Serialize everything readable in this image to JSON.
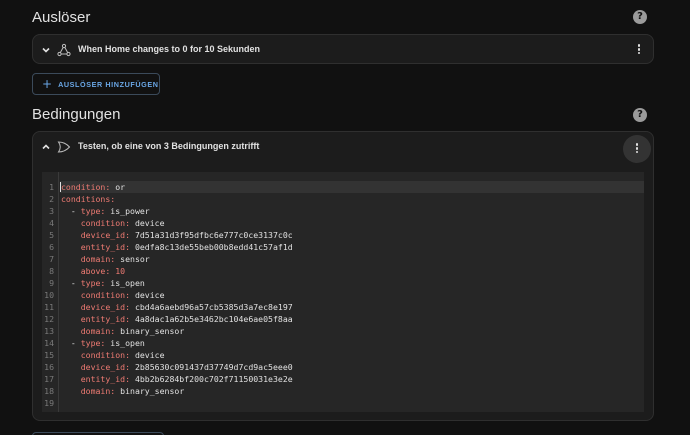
{
  "triggers": {
    "title": "Auslöser",
    "items": [
      {
        "label": "When Home changes to 0 for 10 Sekunden"
      }
    ],
    "add_button_label": "AUSLÖSER HINZUFÜGEN"
  },
  "conditions": {
    "title": "Bedingungen",
    "items": [
      {
        "label": "Testen, ob eine von 3 Bedingungen zutrifft"
      }
    ]
  },
  "editor": {
    "lines": [
      {
        "n": "1",
        "indent": "",
        "key": "condition:",
        "value": " or"
      },
      {
        "n": "2",
        "indent": "",
        "key": "conditions:",
        "value": ""
      },
      {
        "n": "3",
        "indent": "  - ",
        "key": "type:",
        "value": " is_power"
      },
      {
        "n": "4",
        "indent": "    ",
        "key": "condition:",
        "value": " device"
      },
      {
        "n": "5",
        "indent": "    ",
        "key": "device_id:",
        "value": " 7d51a31d3f95dfbc6e777c0ce3137c0c"
      },
      {
        "n": "6",
        "indent": "    ",
        "key": "entity_id:",
        "value": " 0edfa8c13de55beb00b8edd41c57af1d"
      },
      {
        "n": "7",
        "indent": "    ",
        "key": "domain:",
        "value": " sensor"
      },
      {
        "n": "8",
        "indent": "    ",
        "key": "above:",
        "value": "",
        "num": " 10"
      },
      {
        "n": "9",
        "indent": "  - ",
        "key": "type:",
        "value": " is_open"
      },
      {
        "n": "10",
        "indent": "    ",
        "key": "condition:",
        "value": " device"
      },
      {
        "n": "11",
        "indent": "    ",
        "key": "device_id:",
        "value": " cbd4a6aebd96a57cb5385d3a7ec8e197"
      },
      {
        "n": "12",
        "indent": "    ",
        "key": "entity_id:",
        "value": " 4a8dac1a62b5e3462bc104e6ae05f8aa"
      },
      {
        "n": "13",
        "indent": "    ",
        "key": "domain:",
        "value": " binary_sensor"
      },
      {
        "n": "14",
        "indent": "  - ",
        "key": "type:",
        "value": " is_open"
      },
      {
        "n": "15",
        "indent": "    ",
        "key": "condition:",
        "value": " device"
      },
      {
        "n": "16",
        "indent": "    ",
        "key": "device_id:",
        "value": " 2b85630c091437d37749d7cd9ac5eee0"
      },
      {
        "n": "17",
        "indent": "    ",
        "key": "entity_id:",
        "value": " 4bb2b6284bf200c702f71150031e3e2e"
      },
      {
        "n": "18",
        "indent": "    ",
        "key": "domain:",
        "value": " binary_sensor"
      },
      {
        "n": "19",
        "indent": "",
        "key": "",
        "value": ""
      }
    ]
  },
  "colors": {
    "background": "#111111",
    "card": "#1c1c1c",
    "accent": "#6aa7e6",
    "yaml_key": "#ef7b73"
  }
}
